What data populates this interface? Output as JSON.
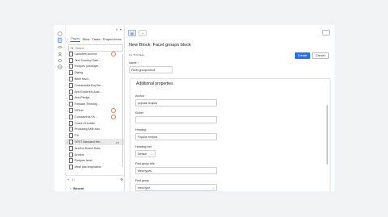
{
  "colors": {
    "accent": "#2f6fdd",
    "badge": "#e07a5f",
    "selected_row": "#e9e9e9"
  },
  "rail": {
    "icons": [
      "info-icon",
      "pages-icon",
      "layers-icon",
      "users-icon",
      "settings-icon",
      "globe-icon"
    ]
  },
  "tree": {
    "top_icons": [
      "ii",
      "▾"
    ],
    "tabs": [
      {
        "label": "Pages"
      },
      {
        "label": "Sites"
      },
      {
        "label": "Tasks"
      },
      {
        "label": "Project items"
      }
    ],
    "search_placeholder": "Search",
    "rows": [
      {
        "label": "Lactofree Archive",
        "chevron": "›",
        "badge": true
      },
      {
        "label": "Test Country Gate...",
        "chevron": "",
        "badge": false
      },
      {
        "label": "Recipes (newstyle...",
        "chevron": "›",
        "badge": false
      },
      {
        "label": "Dialog",
        "chevron": "",
        "badge": false
      },
      {
        "label": "Bibel test 1",
        "chevron": "›",
        "badge": false
      },
      {
        "label": "Crossmedia Buy Ba...",
        "chevron": "›",
        "badge": false
      },
      {
        "label": "Arla Explorers Aust...",
        "chevron": "",
        "badge": false
      },
      {
        "label": "Arla Pledge",
        "chevron": "›",
        "badge": false
      },
      {
        "label": "Forward Thinking ...",
        "chevron": "›",
        "badge": false
      },
      {
        "label": "25Test",
        "chevron": "›",
        "badge": true
      },
      {
        "label": "Coronavirus FA...",
        "chevron": "",
        "badge": true
      },
      {
        "label": "Covid-19 Article",
        "chevron": "",
        "badge": false
      },
      {
        "label": "Producing Milk duri...",
        "chevron": "",
        "badge": false
      },
      {
        "label": "CH",
        "chevron": "›",
        "badge": false
      },
      {
        "label": "TEST Standard Her...",
        "chevron": "›",
        "badge": false,
        "selected": true,
        "more": "•••"
      },
      {
        "label": "Archive Brand Hubs",
        "chevron": "›",
        "badge": false
      },
      {
        "label": "Archive",
        "chevron": "›",
        "badge": false
      },
      {
        "label": "Recipes facet",
        "chevron": "",
        "badge": false
      },
      {
        "label": "Meal plan inspiration",
        "chevron": "",
        "badge": false
      }
    ],
    "bottom_add": "+",
    "bottom_sort": "↑↓",
    "recent_label": "Recent"
  },
  "main": {
    "title": "New Block: Facet groups block",
    "for_this_page": "For This Page",
    "save_label": "Create",
    "cancel_label": "Cancel",
    "name_label": "Name",
    "name_value": "Facet groups block",
    "props_title": "Additional properties",
    "fields": {
      "anchor_label": "Anchor",
      "anchor_value": "popular-recipes",
      "kicker_label": "Kicker",
      "kicker_value": "",
      "heading_label": "Heading",
      "heading_value": "Popular recipes",
      "heading_font_label": "Heading font",
      "heading_font_value": "Default",
      "first_group_title_label": "First group title",
      "first_group_title_value": "Meal types",
      "first_group_label": "First group",
      "first_group_value": "meal type"
    }
  }
}
